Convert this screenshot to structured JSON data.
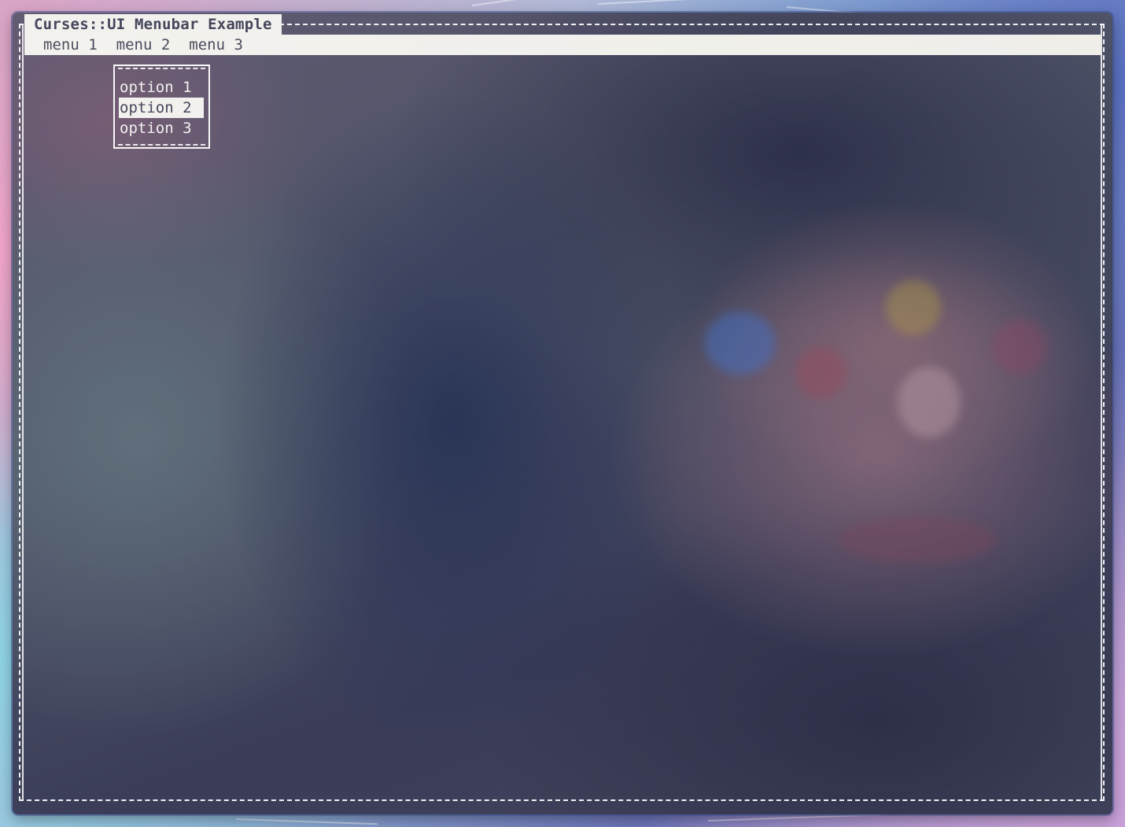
{
  "window": {
    "title": "Curses::UI Menubar Example"
  },
  "menubar": {
    "items": [
      {
        "label": "menu 1"
      },
      {
        "label": "menu 2"
      },
      {
        "label": "menu 3"
      }
    ]
  },
  "dropdown": {
    "parent_menu": "menu 2",
    "options": [
      {
        "label": "option 1",
        "selected": false
      },
      {
        "label": "option 2",
        "selected": true
      },
      {
        "label": "option 3",
        "selected": false
      }
    ]
  },
  "colors": {
    "terminal_fg": "#f2f2f0",
    "highlight_bg": "#f2f1ee",
    "highlight_fg": "#45465a"
  }
}
